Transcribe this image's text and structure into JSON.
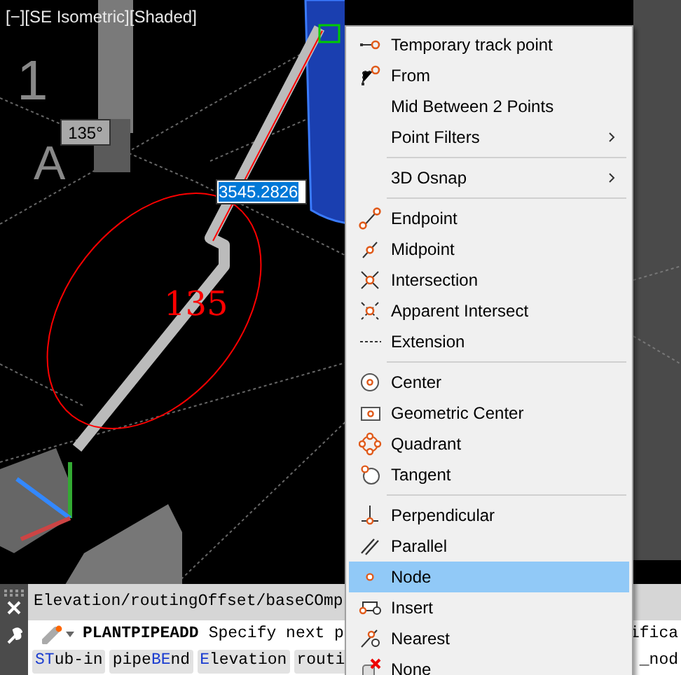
{
  "viewport": {
    "label": "[−][SE Isometric][Shaded]",
    "marks": [
      "1",
      "A"
    ],
    "angle_tooltip": "135°",
    "distance_input": "3545.2826",
    "angle_text": "135"
  },
  "context_menu": {
    "items": [
      {
        "kind": "item",
        "label": "Temporary track point",
        "submenu": false,
        "selected": false
      },
      {
        "kind": "item",
        "label": "From",
        "submenu": false,
        "selected": false
      },
      {
        "kind": "item",
        "label": "Mid Between 2 Points",
        "submenu": false,
        "selected": false
      },
      {
        "kind": "item",
        "label": "Point Filters",
        "submenu": true,
        "selected": false
      },
      {
        "kind": "separator"
      },
      {
        "kind": "item",
        "label": "3D Osnap",
        "submenu": true,
        "selected": false
      },
      {
        "kind": "separator"
      },
      {
        "kind": "item",
        "label": "Endpoint",
        "submenu": false,
        "selected": false
      },
      {
        "kind": "item",
        "label": "Midpoint",
        "submenu": false,
        "selected": false
      },
      {
        "kind": "item",
        "label": "Intersection",
        "submenu": false,
        "selected": false
      },
      {
        "kind": "item",
        "label": "Apparent Intersect",
        "submenu": false,
        "selected": false
      },
      {
        "kind": "item",
        "label": "Extension",
        "submenu": false,
        "selected": false
      },
      {
        "kind": "separator"
      },
      {
        "kind": "item",
        "label": "Center",
        "submenu": false,
        "selected": false
      },
      {
        "kind": "item",
        "label": "Geometric Center",
        "submenu": false,
        "selected": false
      },
      {
        "kind": "item",
        "label": "Quadrant",
        "submenu": false,
        "selected": false
      },
      {
        "kind": "item",
        "label": "Tangent",
        "submenu": false,
        "selected": false
      },
      {
        "kind": "separator"
      },
      {
        "kind": "item",
        "label": "Perpendicular",
        "submenu": false,
        "selected": false
      },
      {
        "kind": "item",
        "label": "Parallel",
        "submenu": false,
        "selected": false
      },
      {
        "kind": "item",
        "label": "Node",
        "submenu": false,
        "selected": true
      },
      {
        "kind": "item",
        "label": "Insert",
        "submenu": false,
        "selected": false
      },
      {
        "kind": "item",
        "label": "Nearest",
        "submenu": false,
        "selected": false
      },
      {
        "kind": "item",
        "label": "None",
        "submenu": false,
        "selected": false
      }
    ]
  },
  "command_line": {
    "history": "Elevation/routingOffset/baseCOmp",
    "command": "PLANTPIPEADD",
    "prompt": "Specify next p",
    "prompt_tail": "ifica",
    "options": [
      [
        {
          "text": "ST",
          "hot": true
        },
        {
          "text": "ub-in",
          "hot": false
        }
      ],
      [
        {
          "text": "pipe",
          "hot": false
        },
        {
          "text": "BE",
          "hot": true
        },
        {
          "text": "nd",
          "hot": false
        }
      ],
      [
        {
          "text": "E",
          "hot": true
        },
        {
          "text": "levation",
          "hot": false
        }
      ],
      [
        {
          "text": "routi",
          "hot": false
        }
      ]
    ],
    "options_tail": "_nod"
  }
}
